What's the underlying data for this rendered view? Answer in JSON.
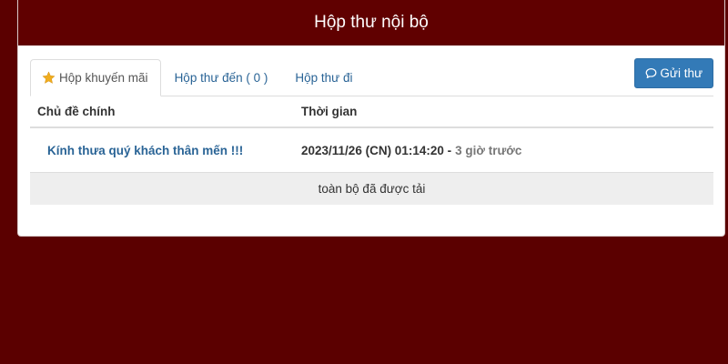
{
  "header": {
    "title": "Hộp thư nội bộ"
  },
  "tabs": [
    {
      "label": "Hộp khuyến mãi",
      "active": true,
      "icon": "star-icon"
    },
    {
      "label": "Hộp thư đến ( 0 )",
      "active": false
    },
    {
      "label": "Hộp thư đi",
      "active": false
    }
  ],
  "actions": {
    "send_label": "Gửi thư",
    "send_icon": "chat-bubble-icon"
  },
  "table": {
    "columns": [
      "Chủ đề chính",
      "Thời gian"
    ],
    "rows": [
      {
        "subject": "Kính thưa quý khách thân mến !!!",
        "time": "2023/11/26 (CN) 01:14:20 -",
        "ago": "3 giờ trước"
      }
    ],
    "footer": "toàn bộ đã được tải"
  },
  "colors": {
    "background": "#5b0000",
    "header": "#600000",
    "link": "#2a6496",
    "button": "#337ab7",
    "star": "#f0ad1e"
  }
}
